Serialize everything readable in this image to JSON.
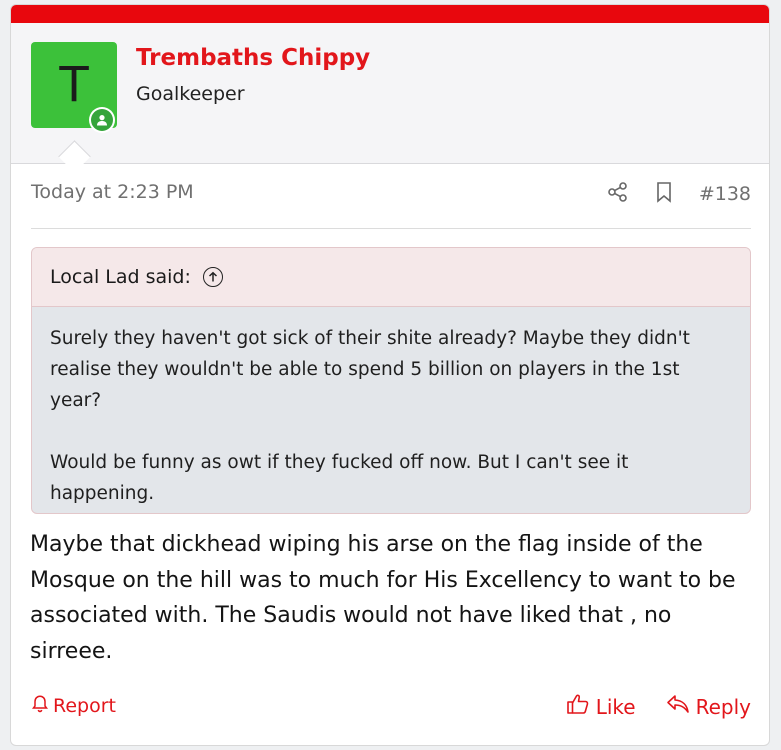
{
  "post": {
    "author": {
      "name": "Trembaths Chippy",
      "title": "Goalkeeper",
      "avatar_letter": "T",
      "avatar_color": "#3cc13a",
      "online": true
    },
    "date": "Today at 2:23 PM",
    "post_number": "#138",
    "quote": {
      "attribution": "Local Lad said:",
      "paragraphs": [
        "Surely they haven't got sick of their shite already? Maybe they didn't realise they wouldn't be able to spend 5 billion on players in the 1st year?",
        "Would be funny as owt if they fucked off now. But I can't see it happening."
      ]
    },
    "message": "Maybe that dickhead wiping his arse on the flag inside of the Mosque on the hill was to much for His Excellency to want to be associated with. The Saudis would not have liked that , no sirreee.",
    "actions": {
      "report": "Report",
      "like": "Like",
      "reply": "Reply"
    }
  },
  "colors": {
    "accent": "#e2161b",
    "topbar": "#e8070d",
    "online": "#35a43b"
  },
  "icons": [
    "share-icon",
    "bookmark-icon",
    "arrow-up-circle-icon",
    "bell-icon",
    "thumbs-up-icon",
    "reply-arrow-icon",
    "online-user-icon"
  ]
}
